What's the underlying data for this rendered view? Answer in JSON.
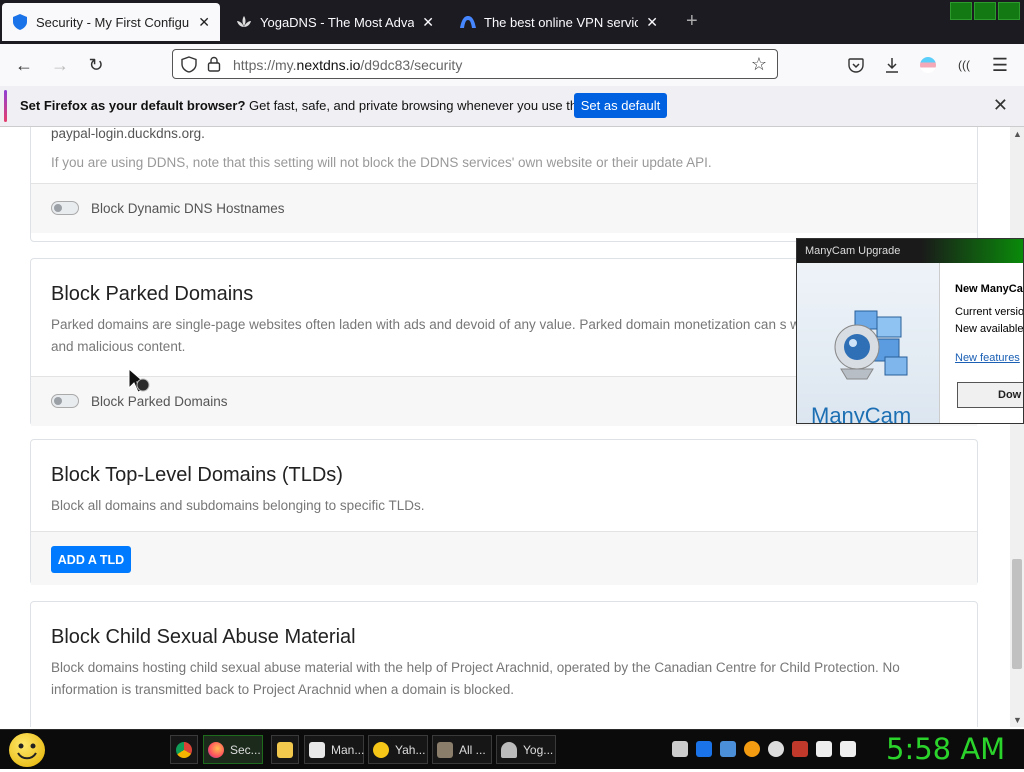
{
  "browser": {
    "tabs": [
      {
        "title": "Security - My First Configuratio",
        "active": true
      },
      {
        "title": "YogaDNS - The Most Advanced",
        "active": false
      },
      {
        "title": "The best online VPN service for",
        "active": false
      }
    ],
    "url_prefix": "https://my.",
    "url_domain": "nextdns.io",
    "url_path": "/d9dc83/security"
  },
  "notification": {
    "bold": "Set Firefox as your default browser?",
    "text": " Get fast, safe, and private browsing whenever you use the web.",
    "button": "Set as default"
  },
  "ddns_card": {
    "partial_text": "paypal-login.duckdns.org.",
    "note": "If you are using DDNS, note that this setting will not block the DDNS services' own website or their update API.",
    "toggle_label": "Block Dynamic DNS Hostnames"
  },
  "parked_card": {
    "title": "Block Parked Domains",
    "desc": "Parked domains are single-page websites often laden with ads and devoid of any value. Parked domain monetization can s with suspicious practices and malicious content.",
    "toggle_label": "Block Parked Domains"
  },
  "tld_card": {
    "title": "Block Top-Level Domains (TLDs)",
    "desc": "Block all domains and subdomains belonging to specific TLDs.",
    "button": "ADD A TLD"
  },
  "csam_card": {
    "title": "Block Child Sexual Abuse Material",
    "desc": "Block domains hosting child sexual abuse material with the help of Project Arachnid, operated by the Canadian Centre for Child Protection. No information is transmitted back to Project Arachnid when a domain is blocked."
  },
  "popup": {
    "titlebar": "ManyCam Upgrade",
    "heading": "New ManyCa",
    "line1": "Current versio",
    "line2": "New available",
    "link": "New features",
    "button": "Dow",
    "logo": "ManyCam"
  },
  "taskbar": {
    "tasks": [
      "Sec...",
      "Man...",
      "Yah...",
      "All ...",
      "Yog..."
    ],
    "clock": "5:58 AM"
  },
  "colors": {
    "primary_button": "#007bff",
    "firefox_blue": "#0061e0",
    "clock_green": "#2bd42b"
  }
}
